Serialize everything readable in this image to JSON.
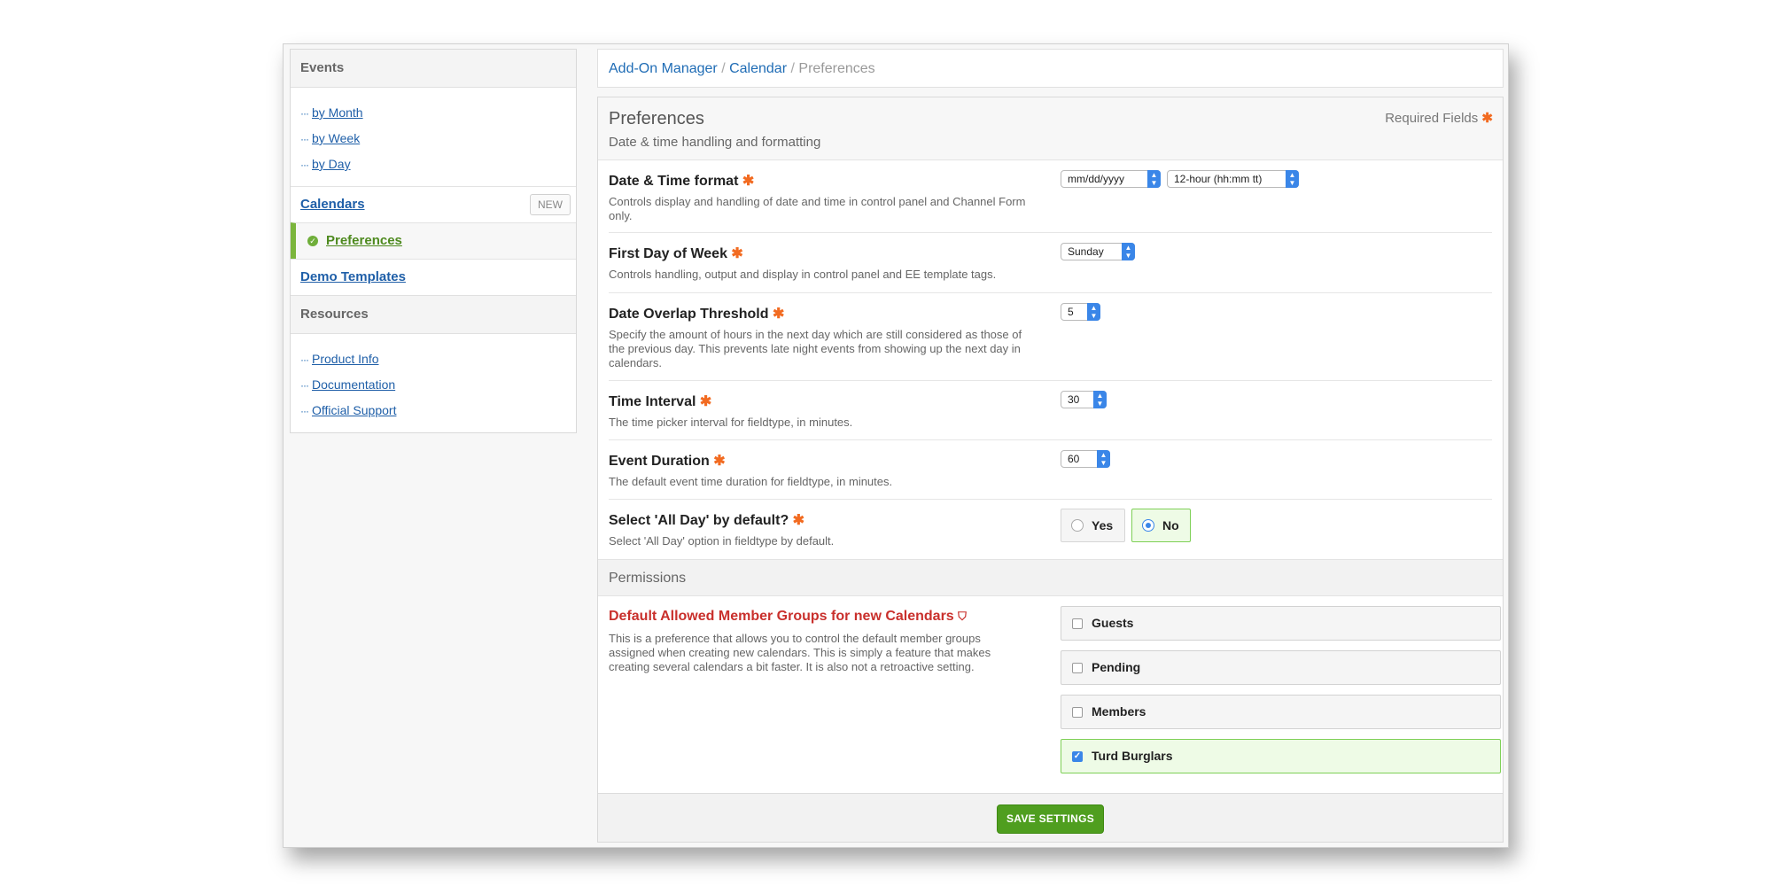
{
  "sidebar": {
    "events_heading": "Events",
    "events_links": [
      "by Month",
      "by Week",
      "by Day"
    ],
    "calendars_label": "Calendars",
    "new_label": "NEW",
    "preferences_label": "Preferences",
    "demo_templates_label": "Demo Templates",
    "resources_heading": "Resources",
    "resource_links": [
      "Product Info",
      "Documentation",
      "Official Support"
    ]
  },
  "breadcrumb": {
    "item1": "Add-On Manager",
    "item2": "Calendar",
    "current": "Preferences",
    "separator": "/"
  },
  "panel": {
    "title": "Preferences",
    "subtitle": "Date & time handling and formatting",
    "required_label": "Required Fields",
    "required_symbol": "✱"
  },
  "fields": {
    "datetime": {
      "label": "Date & Time format",
      "desc": "Controls display and handling of date and time in control panel and Channel Form only.",
      "date_value": "mm/dd/yyyy",
      "time_value": "12-hour (hh:mm tt)"
    },
    "first_day": {
      "label": "First Day of Week",
      "desc": "Controls handling, output and display in control panel and EE template tags.",
      "value": "Sunday"
    },
    "overlap": {
      "label": "Date Overlap Threshold",
      "desc": "Specify the amount of hours in the next day which are still considered as those of the previous day. This prevents late night events from showing up the next day in calendars.",
      "value": "5"
    },
    "interval": {
      "label": "Time Interval",
      "desc": "The time picker interval for fieldtype, in minutes.",
      "value": "30"
    },
    "duration": {
      "label": "Event Duration",
      "desc": "The default event time duration for fieldtype, in minutes.",
      "value": "60"
    },
    "all_day": {
      "label": "Select 'All Day' by default?",
      "desc": "Select 'All Day' option in fieldtype by default.",
      "yes": "Yes",
      "no": "No",
      "selected": "No"
    }
  },
  "permissions": {
    "heading": "Permissions",
    "label": "Default Allowed Member Groups for new Calendars",
    "desc": "This is a preference that allows you to control the default member groups assigned when creating new calendars. This is simply a feature that makes creating several calendars a bit faster. It is also not a retroactive setting.",
    "groups": [
      "Guests",
      "Pending",
      "Members",
      "Turd Burglars"
    ],
    "checked": [
      "Turd Burglars"
    ]
  },
  "footer": {
    "save_label": "SAVE SETTINGS"
  },
  "colors": {
    "accent_blue": "#1f6cb5",
    "required_orange": "#f26b21",
    "permission_red": "#c9302c",
    "save_green": "#4f9e1f",
    "active_green": "#7bb53c"
  }
}
